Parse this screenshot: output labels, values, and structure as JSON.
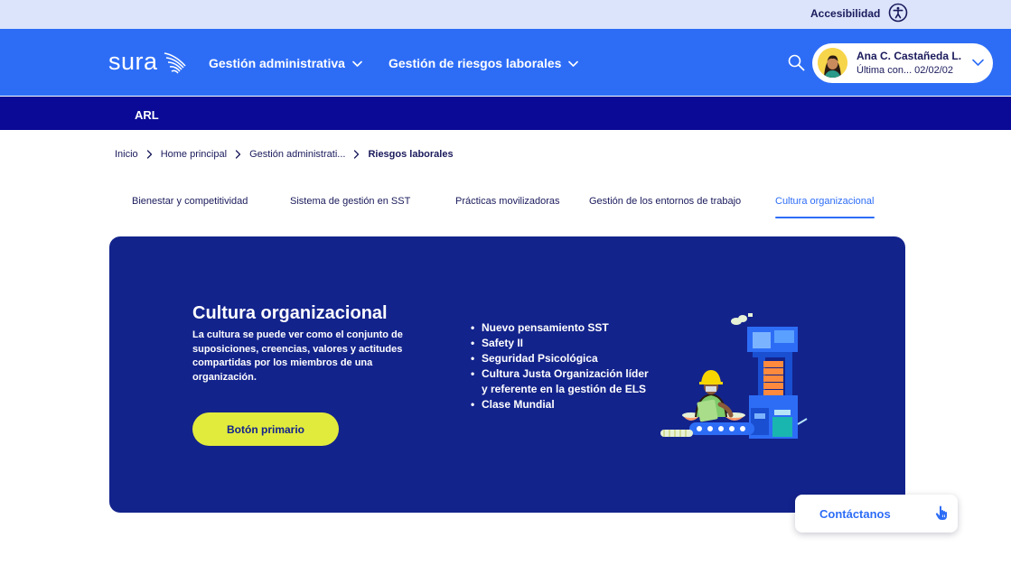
{
  "utility_bar": {
    "accessibility_label": "Accesibilidad",
    "accessibility_icon": "accessibility-icon"
  },
  "header": {
    "logo_text": "sura",
    "nav": [
      {
        "label": "Gestión administrativa",
        "icon": "chevron-down-icon"
      },
      {
        "label": "Gestión de riesgos laborales",
        "icon": "chevron-down-icon"
      }
    ],
    "search_icon": "search-icon",
    "user": {
      "name": "Ana C. Castañeda L.",
      "last_access": "Última con... 02/02/02",
      "avatar_icon": "avatar"
    }
  },
  "sub_nav": {
    "label": "ARL"
  },
  "breadcrumb": [
    {
      "label": "Inicio"
    },
    {
      "label": "Home principal"
    },
    {
      "label": "Gestión administrati..."
    },
    {
      "label": "Riesgos laborales"
    }
  ],
  "tabs": [
    {
      "label": "Bienestar y competitividad",
      "active": false
    },
    {
      "label": "Sistema de gestión en SST",
      "active": false
    },
    {
      "label": "Prácticas movilizadoras",
      "active": false
    },
    {
      "label": "Gestión de los entornos de trabajo",
      "active": false
    },
    {
      "label": "Cultura organizacional",
      "active": true
    }
  ],
  "hero": {
    "title": "Cultura organizacional",
    "description": "La cultura se puede ver como el conjunto de suposiciones, creencias, valores y actitudes compartidas por los miembros de una organización.",
    "button_label": "Botón primario",
    "list": [
      "Nuevo pensamiento SST",
      "Safety II",
      "Seguridad Psicológica",
      "Cultura Justa Organización líder y referente en la gestión de ELS",
      "Clase Mundial"
    ],
    "illustration": "factory-worker-illustration"
  },
  "contact": {
    "label": "Contáctanos",
    "icon": "pointer-hand-icon"
  },
  "colors": {
    "brand_blue": "#2d6df6",
    "deep_navy": "#0a0a96",
    "hero_bg": "#13238c",
    "utility_bg": "#dbe4fb",
    "button_yellow": "#e1eb3c"
  }
}
